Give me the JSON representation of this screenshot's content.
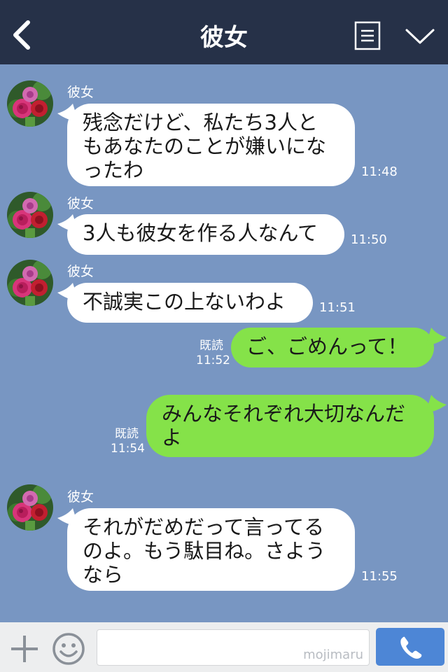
{
  "header": {
    "title": "彼女",
    "background": "#263148"
  },
  "chat": {
    "background": "#7896c2",
    "messages": [
      {
        "side": "in",
        "sender": "彼女",
        "text": "残念だけど、私たち3人と\nもあなたのことが嫌いにな\nったわ",
        "time": "11:48"
      },
      {
        "side": "in",
        "sender": "彼女",
        "text": "3人も彼女を作る人なんて",
        "time": "11:50"
      },
      {
        "side": "in",
        "sender": "彼女",
        "text": "不誠実この上ないわよ",
        "time": "11:51"
      },
      {
        "side": "out",
        "read": "既読",
        "text": "ご、ごめんって！",
        "time": "11:52"
      },
      {
        "side": "out",
        "read": "既読",
        "text": "みんなそれぞれ大切なんだ\nよ",
        "time": "11:54"
      },
      {
        "side": "in",
        "sender": "彼女",
        "text": "それがだめだって言ってる\nのよ。もう駄目ね。さよう\nなら",
        "time": "11:55"
      }
    ]
  },
  "footer": {
    "input_value": "",
    "watermark": "mojimaru",
    "call_color": "#4d86d6"
  },
  "colors": {
    "incoming_bubble": "#ffffff",
    "outgoing_bubble": "#85e249"
  }
}
